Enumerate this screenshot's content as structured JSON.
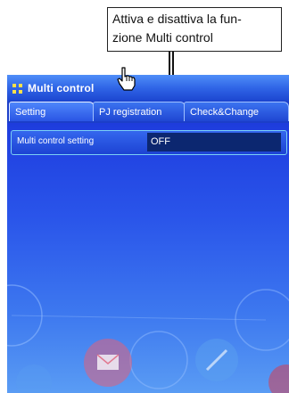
{
  "callout": {
    "line1": "Attiva e disattiva la fun-",
    "line2": "zione Multi control"
  },
  "window": {
    "title": "Multi control"
  },
  "tabs": [
    {
      "label": "Setting",
      "active": true
    },
    {
      "label": "PJ registration",
      "active": false
    },
    {
      "label": "Check&Change",
      "active": false
    }
  ],
  "setting": {
    "label": "Multi control setting",
    "value": "OFF"
  },
  "colors": {
    "panel_blue": "#1f3fe0",
    "highlight_border": "#7bd0f5",
    "value_box": "#0c2770"
  }
}
